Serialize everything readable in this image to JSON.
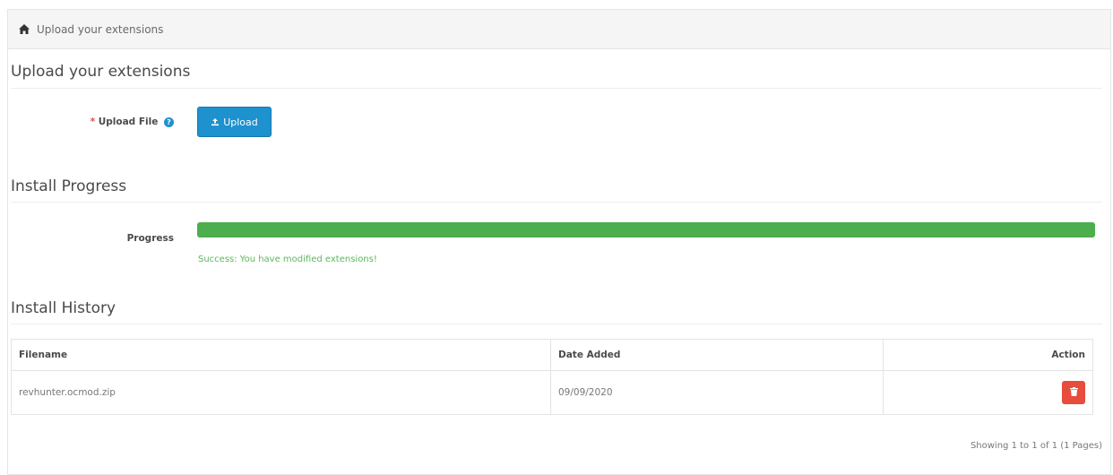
{
  "breadcrumb": {
    "label": "Upload your extensions",
    "icon": "home-icon"
  },
  "upload_section": {
    "title": "Upload your extensions",
    "field_label": "Upload File",
    "required_marker": "*",
    "help_icon": "question-circle-icon",
    "button_label": "Upload",
    "button_icon": "upload-icon"
  },
  "progress_section": {
    "title": "Install Progress",
    "label": "Progress",
    "percent": 100,
    "message": "Success: You have modified extensions!"
  },
  "history_section": {
    "title": "Install History",
    "columns": {
      "filename": "Filename",
      "date_added": "Date Added",
      "action": "Action"
    },
    "rows": [
      {
        "filename": "revhunter.ocmod.zip",
        "date_added": "09/09/2020",
        "action_icon": "trash-icon"
      }
    ],
    "pagination": "Showing 1 to 1 of 1 (1 Pages)"
  },
  "colors": {
    "primary": "#1e91cf",
    "success": "#4cae4c",
    "danger": "#e74c3c",
    "required": "#d9534f"
  }
}
